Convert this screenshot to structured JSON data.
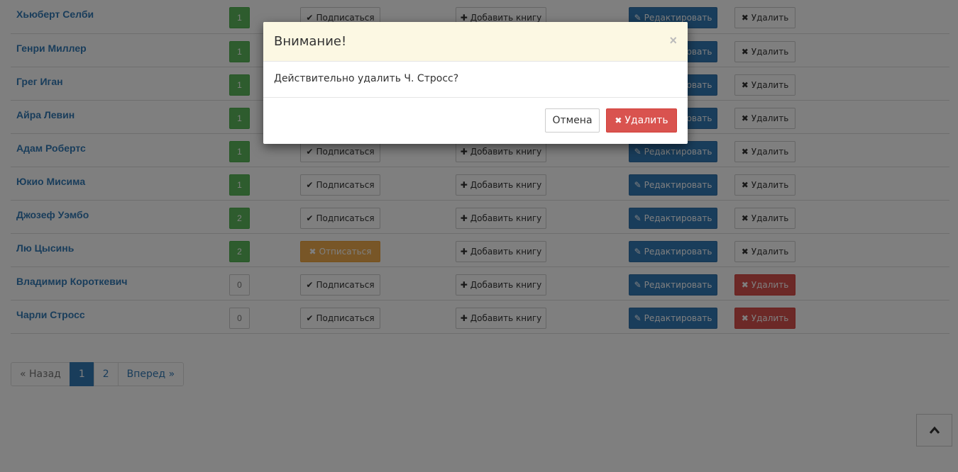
{
  "authors": [
    {
      "name": "Хьюберт Селби",
      "count": "1",
      "subscribed": false,
      "delete_active": false
    },
    {
      "name": "Генри Миллер",
      "count": "1",
      "subscribed": false,
      "delete_active": false
    },
    {
      "name": "Грег Иган",
      "count": "1",
      "subscribed": false,
      "delete_active": false
    },
    {
      "name": "Айра Левин",
      "count": "1",
      "subscribed": false,
      "delete_active": false
    },
    {
      "name": "Адам Робертс",
      "count": "1",
      "subscribed": false,
      "delete_active": false
    },
    {
      "name": "Юкио Мисима",
      "count": "1",
      "subscribed": false,
      "delete_active": false
    },
    {
      "name": "Джозеф Уэмбо",
      "count": "2",
      "subscribed": false,
      "delete_active": false
    },
    {
      "name": "Лю Цысинь",
      "count": "2",
      "subscribed": true,
      "delete_active": false
    },
    {
      "name": "Владимир Короткевич",
      "count": "0",
      "subscribed": false,
      "delete_active": true
    },
    {
      "name": "Чарли Стросс",
      "count": "0",
      "subscribed": false,
      "delete_active": true
    }
  ],
  "labels": {
    "subscribe": "Подписаться",
    "unsubscribe": "Отписаться",
    "add_book": "Добавить книгу",
    "edit": "Редактировать",
    "delete": "Удалить"
  },
  "pagination": {
    "prev": "« Назад",
    "pages": [
      "1",
      "2"
    ],
    "active": "1",
    "next": "Вперед »"
  },
  "modal": {
    "title": "Внимание!",
    "close": "×",
    "message": "Действительно удалить Ч. Стросс?",
    "cancel": "Отмена",
    "confirm": "Удалить"
  },
  "icons": {
    "check": "check-icon",
    "plus": "plus-icon",
    "edit": "edit-icon",
    "times": "times-icon",
    "chevron_up": "chevron-up-icon"
  },
  "colors": {
    "primary": "#337ab7",
    "success": "#5cb85c",
    "warning": "#f0ad4e",
    "danger": "#d9534f",
    "modal_header": "#fcf8e3"
  }
}
